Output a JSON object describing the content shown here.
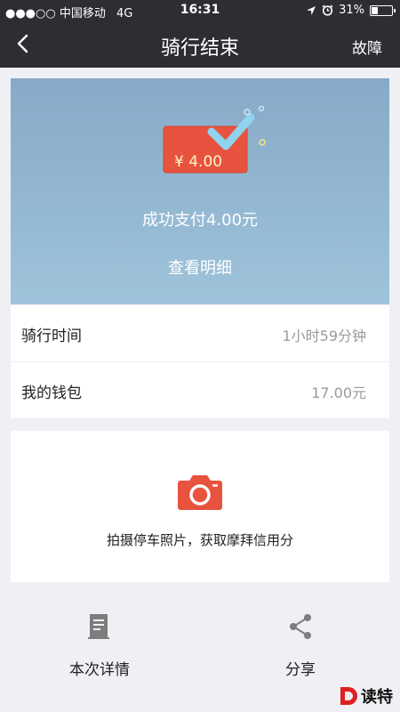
{
  "status_bar": {
    "signal": "●●●○○",
    "carrier": "中国移动",
    "network": "4G",
    "time": "16:31",
    "battery": "31%",
    "battery_level": 0.31
  },
  "nav": {
    "title": "骑行结束",
    "right_label": "故障"
  },
  "hero": {
    "amount_tag": "¥ 4.00",
    "pay_text": "成功支付4.00元",
    "detail_link": "查看明细"
  },
  "rows": {
    "time_label": "骑行时间",
    "time_value": "1小时59分钟",
    "wallet_label": "我的钱包",
    "wallet_value": "17.00元"
  },
  "photo_card": {
    "text": "拍摄停车照片，获取摩拜信用分"
  },
  "bottom": {
    "detail_label": "本次详情",
    "share_label": "分享"
  },
  "watermark": {
    "text": "读特"
  },
  "colors": {
    "topbar": "#2c2e34",
    "accent_red": "#e8533f",
    "check_blue": "#8fd3ee"
  }
}
